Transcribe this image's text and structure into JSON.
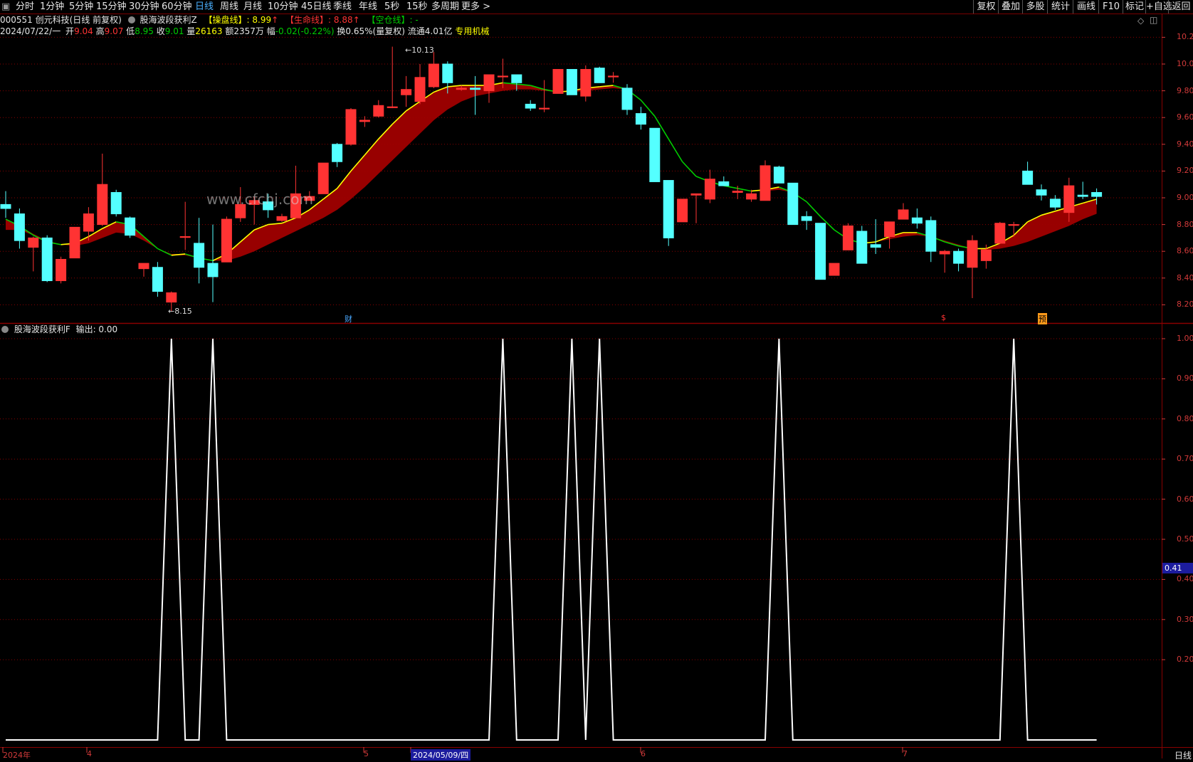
{
  "toolbar": {
    "periods": [
      "分时",
      "1分钟",
      "5分钟",
      "15分钟",
      "30分钟",
      "60分钟",
      "日线",
      "周线",
      "月线",
      "10分钟",
      "45日线",
      "季线",
      "年线",
      "5秒",
      "15秒",
      "多周期",
      "更多 >"
    ],
    "active_period": "日线",
    "right_buttons": [
      "复权",
      "叠加",
      "多股",
      "统计",
      "画线",
      "F10",
      "标记",
      "+自选",
      "返回"
    ]
  },
  "header": {
    "code_name": "000551 创元科技(日线 前复权)",
    "indicator_name": "股海波段获利Z",
    "cpx_label": "【操盘线】",
    "cpx_value": ": 8.99",
    "smx_label": "【生命线】",
    "smx_value": ": 8.88",
    "kcx_label": "【空仓线】",
    "kcx_value": ": -"
  },
  "quote": {
    "date": "2024/07/22/一",
    "open_label": "开",
    "open": "9.04",
    "high_label": "高",
    "high": "9.07",
    "low_label": "低",
    "low": "8.95",
    "close_label": "收",
    "close": "9.01",
    "vol_label": "量",
    "vol": "26163",
    "amount": "额2357万",
    "change_label": "幅",
    "change": "-0.02(-0.22%)",
    "turnover": "换0.65%(量复权)",
    "float_cap": "流通4.01亿",
    "sector": "专用机械"
  },
  "annotations": {
    "high_mark": "10.13",
    "low_mark": "8.15",
    "watermark": "www.cfchj.com",
    "event_cai": "财",
    "event_dollar": "$",
    "event_yu": "预"
  },
  "sub_panel": {
    "title": "股海波段获利F",
    "output_label": "输出: 0.00",
    "cursor_value": "0.41"
  },
  "axes": {
    "main_y_ticks": [
      "10.20",
      "10.00",
      "9.80",
      "9.60",
      "9.40",
      "9.20",
      "9.00",
      "8.80",
      "8.60",
      "8.40",
      "8.20"
    ],
    "sub_y_ticks": [
      "1.00",
      "0.90",
      "0.80",
      "0.70",
      "0.60",
      "0.50",
      "0.40",
      "0.30",
      "0.20"
    ],
    "x_labels": [
      "2024年",
      "4",
      "5",
      "2024/05/09/四",
      "6",
      "7"
    ],
    "period_label": "日线"
  },
  "colors": {
    "up": "#ff3333",
    "down": "#54ffff",
    "ma_fast_up": "#ffff00",
    "ma_fast_down": "#00cc00",
    "ribbon": "#a00000",
    "grid": "#8a0000",
    "signal": "#ffffff"
  },
  "chart_data": {
    "type": "candlestick",
    "title": "000551 创元科技(日线 前复权)",
    "ylim": [
      8.1,
      10.3
    ],
    "candles": [
      {
        "o": 8.95,
        "h": 9.05,
        "l": 8.85,
        "c": 8.92
      },
      {
        "o": 8.88,
        "h": 8.92,
        "l": 8.62,
        "c": 8.68
      },
      {
        "o": 8.63,
        "h": 8.71,
        "l": 8.45,
        "c": 8.7
      },
      {
        "o": 8.7,
        "h": 8.72,
        "l": 8.37,
        "c": 8.38
      },
      {
        "o": 8.38,
        "h": 8.56,
        "l": 8.36,
        "c": 8.54
      },
      {
        "o": 8.55,
        "h": 8.78,
        "l": 8.55,
        "c": 8.78
      },
      {
        "o": 8.75,
        "h": 8.93,
        "l": 8.68,
        "c": 8.88
      },
      {
        "o": 8.8,
        "h": 9.33,
        "l": 8.79,
        "c": 9.1
      },
      {
        "o": 9.04,
        "h": 9.06,
        "l": 8.86,
        "c": 8.88
      },
      {
        "o": 8.85,
        "h": 8.86,
        "l": 8.7,
        "c": 8.72
      },
      {
        "o": 8.47,
        "h": 8.5,
        "l": 8.41,
        "c": 8.51
      },
      {
        "o": 8.48,
        "h": 8.52,
        "l": 8.26,
        "c": 8.3
      },
      {
        "o": 8.22,
        "h": 8.3,
        "l": 8.15,
        "c": 8.29
      },
      {
        "o": 8.71,
        "h": 8.97,
        "l": 8.61,
        "c": 8.71
      },
      {
        "o": 8.66,
        "h": 8.85,
        "l": 8.36,
        "c": 8.48
      },
      {
        "o": 8.51,
        "h": 8.8,
        "l": 8.22,
        "c": 8.41
      },
      {
        "o": 8.52,
        "h": 8.86,
        "l": 8.52,
        "c": 8.84
      },
      {
        "o": 8.85,
        "h": 9.08,
        "l": 8.82,
        "c": 8.95
      },
      {
        "o": 8.95,
        "h": 9.01,
        "l": 8.8,
        "c": 8.98
      },
      {
        "o": 8.97,
        "h": 9.03,
        "l": 8.85,
        "c": 8.91
      },
      {
        "o": 8.83,
        "h": 8.88,
        "l": 8.82,
        "c": 8.86
      },
      {
        "o": 8.85,
        "h": 9.24,
        "l": 8.85,
        "c": 9.03
      },
      {
        "o": 8.98,
        "h": 9.05,
        "l": 8.99,
        "c": 9.01
      },
      {
        "o": 9.03,
        "h": 9.26,
        "l": 9.03,
        "c": 9.26
      },
      {
        "o": 9.4,
        "h": 9.41,
        "l": 9.23,
        "c": 9.27
      },
      {
        "o": 9.4,
        "h": 9.67,
        "l": 9.39,
        "c": 9.66
      },
      {
        "o": 9.57,
        "h": 9.61,
        "l": 9.53,
        "c": 9.58
      },
      {
        "o": 9.61,
        "h": 9.73,
        "l": 9.6,
        "c": 9.69
      },
      {
        "o": 9.68,
        "h": 10.13,
        "l": 9.67,
        "c": 9.68
      },
      {
        "o": 9.77,
        "h": 9.91,
        "l": 9.68,
        "c": 9.81
      },
      {
        "o": 9.72,
        "h": 10.0,
        "l": 9.7,
        "c": 9.9
      },
      {
        "o": 9.83,
        "h": 10.09,
        "l": 9.82,
        "c": 10.0
      },
      {
        "o": 10.0,
        "h": 10.02,
        "l": 9.78,
        "c": 9.86
      },
      {
        "o": 9.81,
        "h": 9.84,
        "l": 9.8,
        "c": 9.82
      },
      {
        "o": 9.82,
        "h": 9.91,
        "l": 9.62,
        "c": 9.81
      },
      {
        "o": 9.8,
        "h": 9.91,
        "l": 9.71,
        "c": 9.92
      },
      {
        "o": 9.91,
        "h": 10.04,
        "l": 9.82,
        "c": 9.91
      },
      {
        "o": 9.92,
        "h": 9.92,
        "l": 9.8,
        "c": 9.86
      },
      {
        "o": 9.7,
        "h": 9.73,
        "l": 9.65,
        "c": 9.67
      },
      {
        "o": 9.67,
        "h": 9.88,
        "l": 9.64,
        "c": 9.67
      },
      {
        "o": 9.78,
        "h": 9.96,
        "l": 9.78,
        "c": 9.96
      },
      {
        "o": 9.96,
        "h": 9.96,
        "l": 9.77,
        "c": 9.77
      },
      {
        "o": 9.76,
        "h": 9.99,
        "l": 9.72,
        "c": 9.96
      },
      {
        "o": 9.97,
        "h": 9.98,
        "l": 9.86,
        "c": 9.86
      },
      {
        "o": 9.91,
        "h": 9.94,
        "l": 9.86,
        "c": 9.91
      },
      {
        "o": 9.82,
        "h": 9.85,
        "l": 9.62,
        "c": 9.66
      },
      {
        "o": 9.63,
        "h": 9.68,
        "l": 9.51,
        "c": 9.55
      },
      {
        "o": 9.52,
        "h": 9.52,
        "l": 9.12,
        "c": 9.12
      },
      {
        "o": 9.13,
        "h": 9.13,
        "l": 8.64,
        "c": 8.7
      },
      {
        "o": 8.82,
        "h": 8.99,
        "l": 8.82,
        "c": 8.99
      },
      {
        "o": 9.02,
        "h": 9.03,
        "l": 8.81,
        "c": 9.03
      },
      {
        "o": 8.99,
        "h": 9.21,
        "l": 8.96,
        "c": 9.14
      },
      {
        "o": 9.12,
        "h": 9.16,
        "l": 9.09,
        "c": 9.09
      },
      {
        "o": 9.04,
        "h": 9.09,
        "l": 8.99,
        "c": 9.05
      },
      {
        "o": 8.99,
        "h": 9.06,
        "l": 8.97,
        "c": 9.03
      },
      {
        "o": 8.98,
        "h": 9.28,
        "l": 8.98,
        "c": 9.24
      },
      {
        "o": 9.23,
        "h": 9.24,
        "l": 9.11,
        "c": 9.11
      },
      {
        "o": 9.11,
        "h": 9.11,
        "l": 8.8,
        "c": 8.8
      },
      {
        "o": 8.86,
        "h": 8.9,
        "l": 8.76,
        "c": 8.83
      },
      {
        "o": 8.81,
        "h": 8.81,
        "l": 8.39,
        "c": 8.39
      },
      {
        "o": 8.42,
        "h": 8.51,
        "l": 8.43,
        "c": 8.51
      },
      {
        "o": 8.61,
        "h": 8.81,
        "l": 8.61,
        "c": 8.79
      },
      {
        "o": 8.75,
        "h": 8.79,
        "l": 8.51,
        "c": 8.51
      },
      {
        "o": 8.65,
        "h": 8.84,
        "l": 8.58,
        "c": 8.63
      },
      {
        "o": 8.71,
        "h": 8.75,
        "l": 8.62,
        "c": 8.82
      },
      {
        "o": 8.84,
        "h": 8.96,
        "l": 8.84,
        "c": 8.91
      },
      {
        "o": 8.85,
        "h": 8.92,
        "l": 8.77,
        "c": 8.81
      },
      {
        "o": 8.83,
        "h": 8.86,
        "l": 8.52,
        "c": 8.6
      },
      {
        "o": 8.58,
        "h": 8.61,
        "l": 8.44,
        "c": 8.6
      },
      {
        "o": 8.6,
        "h": 8.62,
        "l": 8.45,
        "c": 8.51
      },
      {
        "o": 8.48,
        "h": 8.72,
        "l": 8.25,
        "c": 8.68
      },
      {
        "o": 8.53,
        "h": 8.65,
        "l": 8.47,
        "c": 8.61
      },
      {
        "o": 8.66,
        "h": 8.82,
        "l": 8.66,
        "c": 8.81
      },
      {
        "o": 8.8,
        "h": 8.82,
        "l": 8.71,
        "c": 8.8
      },
      {
        "o": 9.2,
        "h": 9.27,
        "l": 9.13,
        "c": 9.1
      },
      {
        "o": 9.06,
        "h": 9.1,
        "l": 8.98,
        "c": 9.02
      },
      {
        "o": 8.99,
        "h": 9.02,
        "l": 8.91,
        "c": 8.93
      },
      {
        "o": 8.89,
        "h": 9.15,
        "l": 8.82,
        "c": 9.09
      },
      {
        "o": 9.02,
        "h": 9.12,
        "l": 8.99,
        "c": 9.01
      },
      {
        "o": 9.04,
        "h": 9.07,
        "l": 8.95,
        "c": 9.01
      }
    ],
    "ma_fast": [
      8.84,
      8.79,
      8.72,
      8.67,
      8.65,
      8.66,
      8.71,
      8.77,
      8.82,
      8.8,
      8.71,
      8.62,
      8.57,
      8.58,
      8.55,
      8.53,
      8.58,
      8.67,
      8.76,
      8.8,
      8.81,
      8.85,
      8.91,
      8.99,
      9.07,
      9.2,
      9.32,
      9.44,
      9.55,
      9.65,
      9.72,
      9.79,
      9.83,
      9.84,
      9.84,
      9.84,
      9.86,
      9.85,
      9.84,
      9.81,
      9.79,
      9.8,
      9.82,
      9.83,
      9.84,
      9.81,
      9.73,
      9.61,
      9.44,
      9.27,
      9.16,
      9.12,
      9.09,
      9.07,
      9.05,
      9.06,
      9.08,
      9.04,
      8.97,
      8.86,
      8.76,
      8.69,
      8.66,
      8.67,
      8.71,
      8.74,
      8.74,
      8.71,
      8.67,
      8.64,
      8.62,
      8.62,
      8.66,
      8.72,
      8.82,
      8.87,
      8.9,
      8.93,
      8.96,
      8.99
    ],
    "ma_slow": [
      8.76,
      8.76,
      8.73,
      8.68,
      8.65,
      8.64,
      8.66,
      8.7,
      8.74,
      8.73,
      8.68,
      8.62,
      8.58,
      8.57,
      8.55,
      8.53,
      8.53,
      8.56,
      8.6,
      8.65,
      8.7,
      8.75,
      8.8,
      8.85,
      8.91,
      8.99,
      9.08,
      9.18,
      9.28,
      9.38,
      9.48,
      9.58,
      9.66,
      9.72,
      9.76,
      9.78,
      9.8,
      9.81,
      9.81,
      9.8,
      9.79,
      9.79,
      9.8,
      9.81,
      9.82,
      9.81,
      9.73,
      9.61,
      9.44,
      9.27,
      9.16,
      9.12,
      9.09,
      9.07,
      9.05,
      9.05,
      9.06,
      9.04,
      8.97,
      8.86,
      8.76,
      8.69,
      8.66,
      8.67,
      8.69,
      8.71,
      8.72,
      8.71,
      8.68,
      8.65,
      8.62,
      8.61,
      8.62,
      8.64,
      8.67,
      8.71,
      8.75,
      8.79,
      8.84,
      8.88
    ],
    "signal_series": [
      0,
      0,
      0,
      0,
      0,
      0,
      0,
      0,
      0,
      0,
      0,
      0,
      1,
      0,
      0,
      1,
      0,
      0,
      0,
      0,
      0,
      0,
      0,
      0,
      0,
      0,
      0,
      0,
      0,
      0,
      0,
      0,
      0,
      0,
      0,
      0,
      1,
      0,
      0,
      0,
      0,
      1,
      0,
      1,
      0,
      0,
      0,
      0,
      0,
      0,
      0,
      0,
      0,
      0,
      0,
      0,
      1,
      0,
      0,
      0,
      0,
      0,
      0,
      0,
      0,
      0,
      0,
      0,
      0,
      0,
      0,
      0,
      0,
      1,
      0,
      0,
      0,
      0,
      0,
      0
    ],
    "sub_ylim": [
      0,
      1.05
    ]
  }
}
